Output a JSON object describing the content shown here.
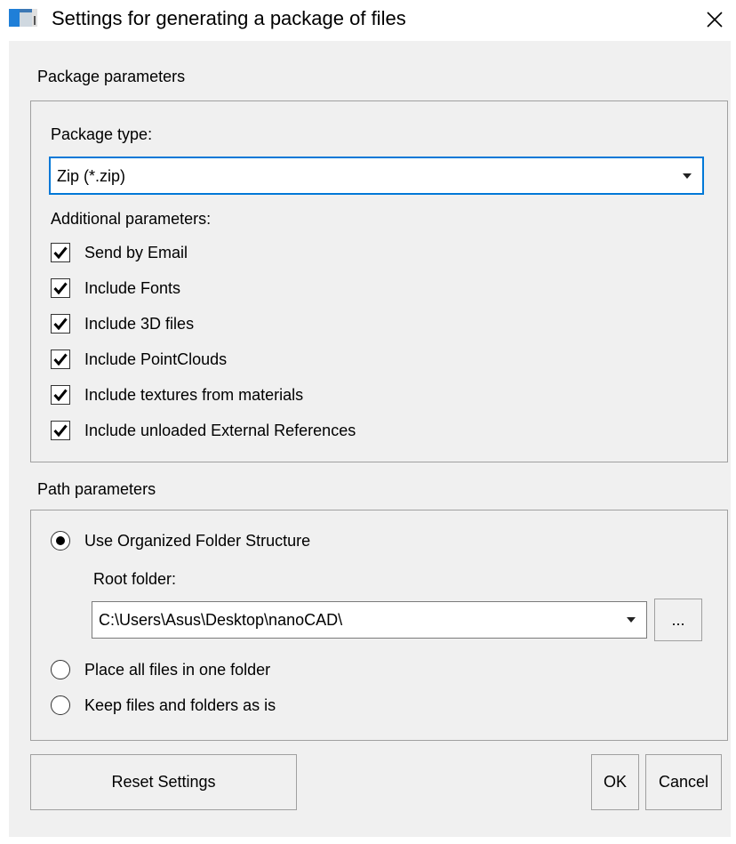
{
  "window": {
    "title": "Settings for generating a package of files"
  },
  "package_params": {
    "section_label": "Package parameters",
    "package_type_label": "Package type:",
    "package_type_value": "Zip (*.zip)",
    "additional_label": "Additional parameters:",
    "options": [
      {
        "label": "Send by Email",
        "checked": true
      },
      {
        "label": "Include Fonts",
        "checked": true
      },
      {
        "label": "Include 3D files",
        "checked": true
      },
      {
        "label": "Include PointClouds",
        "checked": true
      },
      {
        "label": "Include textures from materials",
        "checked": true
      },
      {
        "label": "Include unloaded External References",
        "checked": true
      }
    ]
  },
  "path_params": {
    "section_label": "Path parameters",
    "options": [
      {
        "label": "Use Organized Folder Structure",
        "selected": true
      },
      {
        "label": "Place all files in one folder",
        "selected": false
      },
      {
        "label": "Keep files and folders as is",
        "selected": false
      }
    ],
    "root_folder_label": "Root folder:",
    "root_folder_value": "C:\\Users\\Asus\\Desktop\\nanoCAD\\",
    "browse_label": "..."
  },
  "buttons": {
    "reset": "Reset Settings",
    "ok": "OK",
    "cancel": "Cancel"
  },
  "icons": {
    "app": "app-window-icon",
    "close": "close-icon",
    "dropdown": "chevron-down-icon",
    "check": "checkmark-icon"
  },
  "colors": {
    "focus_border": "#0078d7",
    "dialog_bg": "#f0f0f0"
  }
}
